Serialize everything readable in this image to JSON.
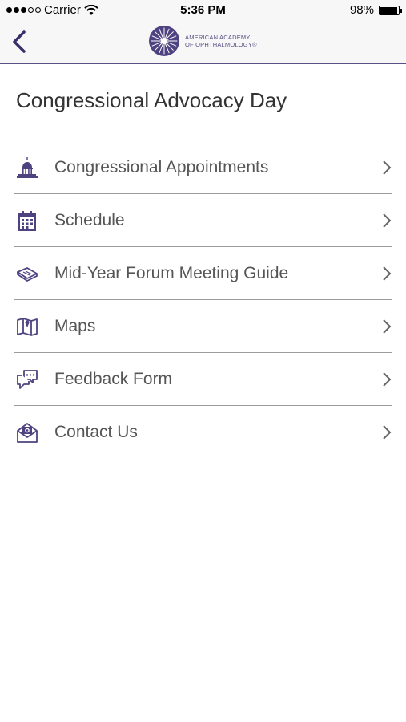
{
  "status_bar": {
    "carrier": "Carrier",
    "time": "5:36 PM",
    "battery": "98%"
  },
  "nav": {
    "logo_line1": "AMERICAN ACADEMY",
    "logo_line2": "OF OPHTHALMOLOGY®",
    "accent_color": "#5b4f86"
  },
  "page": {
    "title": "Congressional Advocacy Day"
  },
  "menu": {
    "items": [
      {
        "label": "Congressional Appointments",
        "icon": "capitol-icon"
      },
      {
        "label": "Schedule",
        "icon": "calendar-icon"
      },
      {
        "label": "Mid-Year Forum Meeting Guide",
        "icon": "book-icon"
      },
      {
        "label": "Maps",
        "icon": "map-icon"
      },
      {
        "label": "Feedback Form",
        "icon": "chat-bubbles-icon"
      },
      {
        "label": "Contact Us",
        "icon": "envelope-icon"
      }
    ]
  }
}
